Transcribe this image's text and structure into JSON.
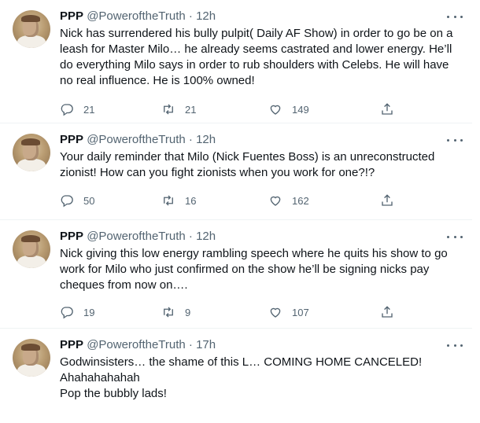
{
  "tweets": [
    {
      "name": "PPP",
      "handle": "@PoweroftheTruth",
      "dot": "·",
      "time": "12h",
      "lines": [
        "Nick has surrendered his bully pulpit( Daily AF Show) in order to go be on a",
        "leash for Master Milo… he already seems castrated and lower energy. He’ll",
        "do everything Milo says in order to rub shoulders with Celebs. He will have",
        "no real influence. He is 100% owned!"
      ],
      "replies": "21",
      "retweets": "21",
      "likes": "149"
    },
    {
      "name": "PPP",
      "handle": "@PoweroftheTruth",
      "dot": "·",
      "time": "12h",
      "lines": [
        "Your daily reminder that Milo (Nick Fuentes Boss) is an unreconstructed",
        "zionist! How can you fight zionists when you work for one?!?"
      ],
      "replies": "50",
      "retweets": "16",
      "likes": "162"
    },
    {
      "name": "PPP",
      "handle": "@PoweroftheTruth",
      "dot": "·",
      "time": "12h",
      "lines": [
        "Nick giving this low energy rambling speech where he quits his show to go",
        "work for Milo who just confirmed on the show he’ll be signing nicks pay",
        "cheques from now on…."
      ],
      "replies": "19",
      "retweets": "9",
      "likes": "107"
    },
    {
      "name": "PPP",
      "handle": "@PoweroftheTruth",
      "dot": "·",
      "time": "17h",
      "lines": [
        "Godwinsisters… the shame of this L… COMING HOME CANCELED!",
        "Ahahahahahah",
        "Pop the bubbly lads!"
      ]
    }
  ],
  "icons": {
    "reply": "reply-icon",
    "retweet": "retweet-icon",
    "like": "like-icon",
    "share": "share-icon",
    "more": "more-icon"
  }
}
